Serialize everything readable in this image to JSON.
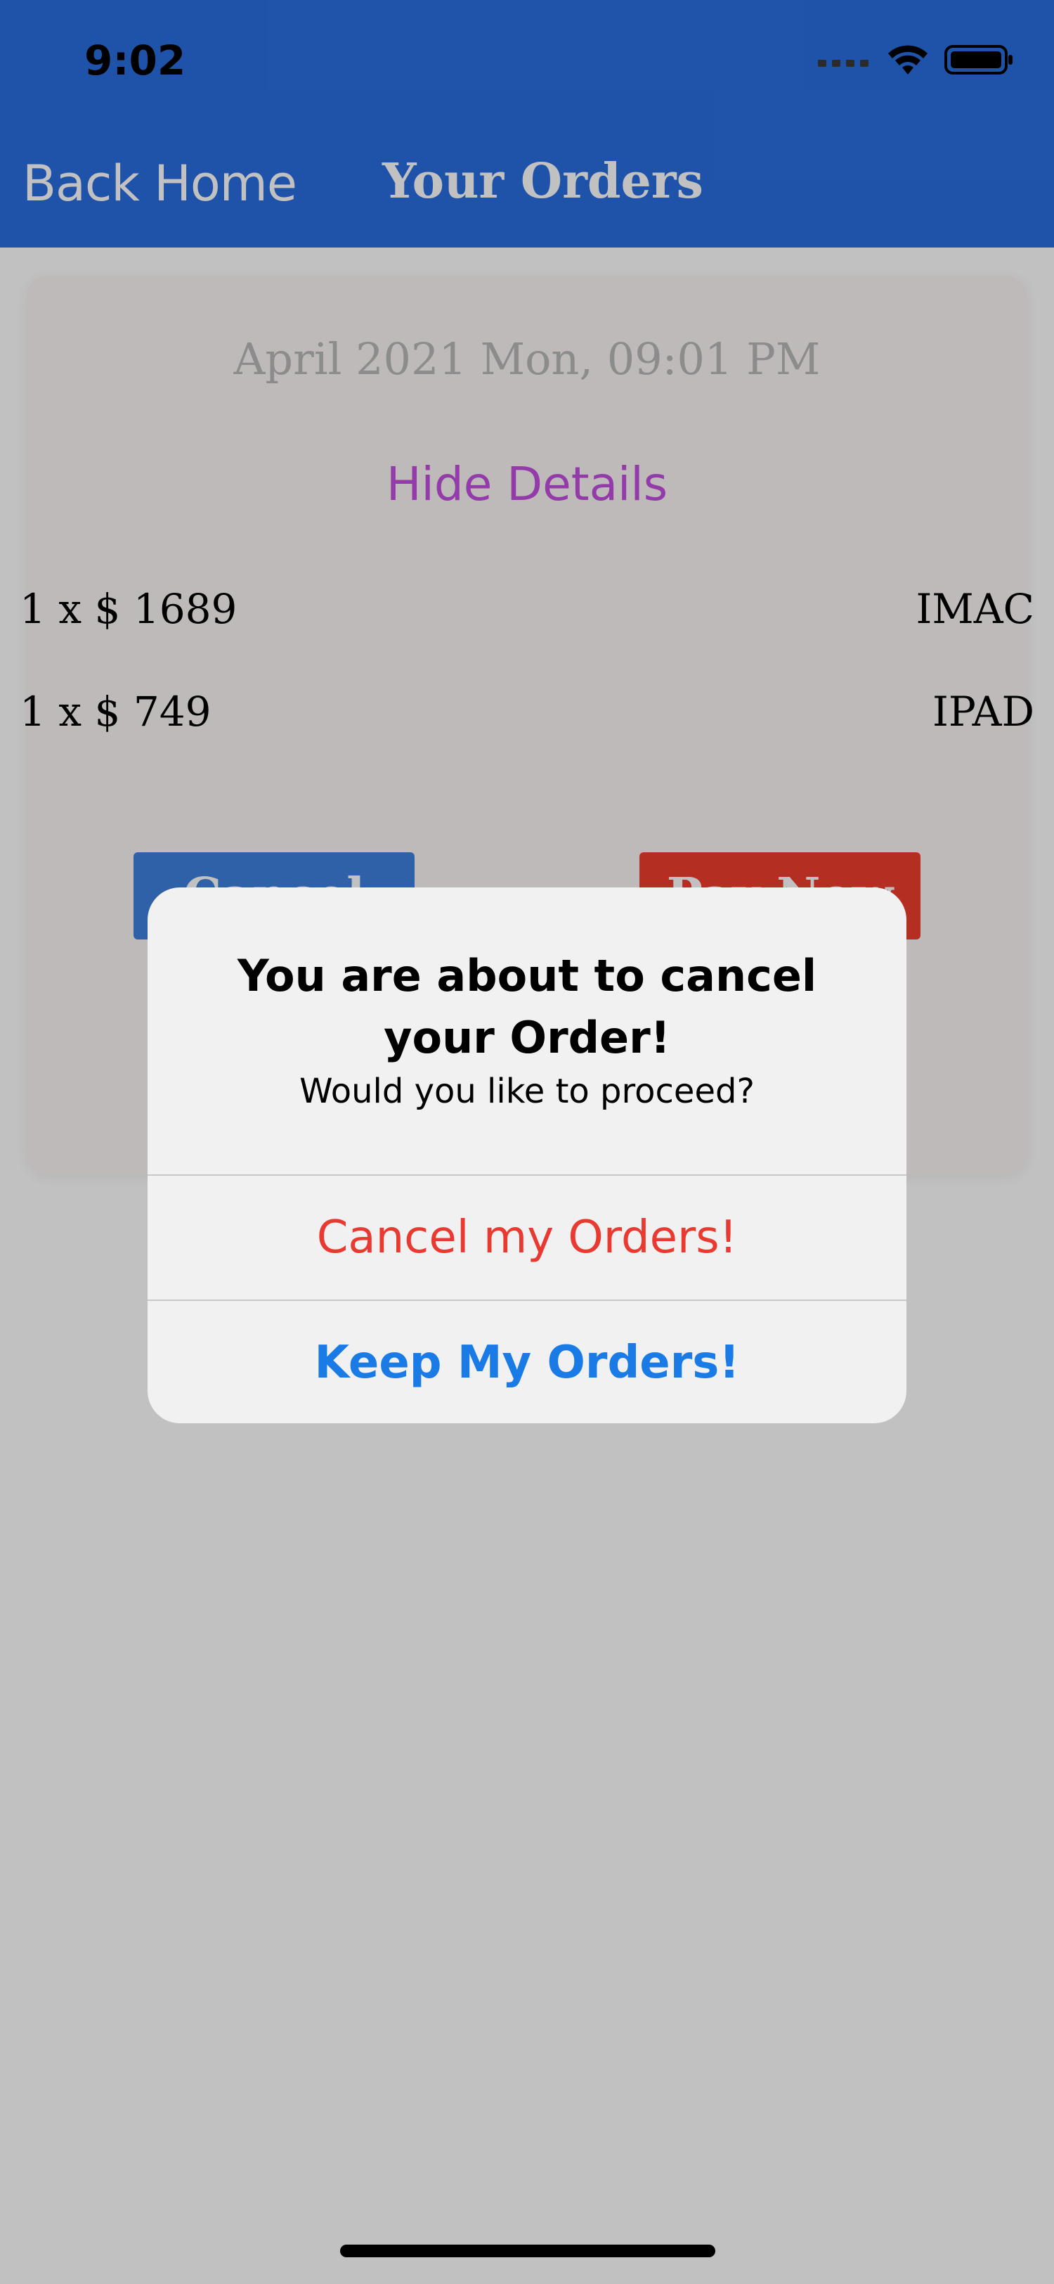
{
  "status_bar": {
    "time": "9:02",
    "signal_icon": "signal-icon",
    "wifi_icon": "wifi-icon",
    "battery_icon": "battery-icon"
  },
  "nav": {
    "back_label": "Back Home",
    "title": "Your Orders"
  },
  "order": {
    "date": "April 2021 Mon, 09:01 PM",
    "toggle_label": "Hide Details",
    "items": [
      {
        "qty_price": "1 x $ 1689",
        "product": "IMAC"
      },
      {
        "qty_price": "1 x $ 749",
        "product": "IPAD"
      }
    ],
    "cancel_label": "Cancel",
    "pay_label": "Pay Now"
  },
  "alert": {
    "title": "You are about to cancel your Order!",
    "message": "Would you like to proceed?",
    "destructive_action": "Cancel my Orders!",
    "keep_action": "Keep My Orders!"
  },
  "colors": {
    "header": "#2a6ee0",
    "accent_purple": "#c24fde",
    "cancel_button": "#3f80e0",
    "pay_button": "#ee3d2c",
    "destructive": "#e83a31",
    "keep": "#1a7ae6"
  }
}
